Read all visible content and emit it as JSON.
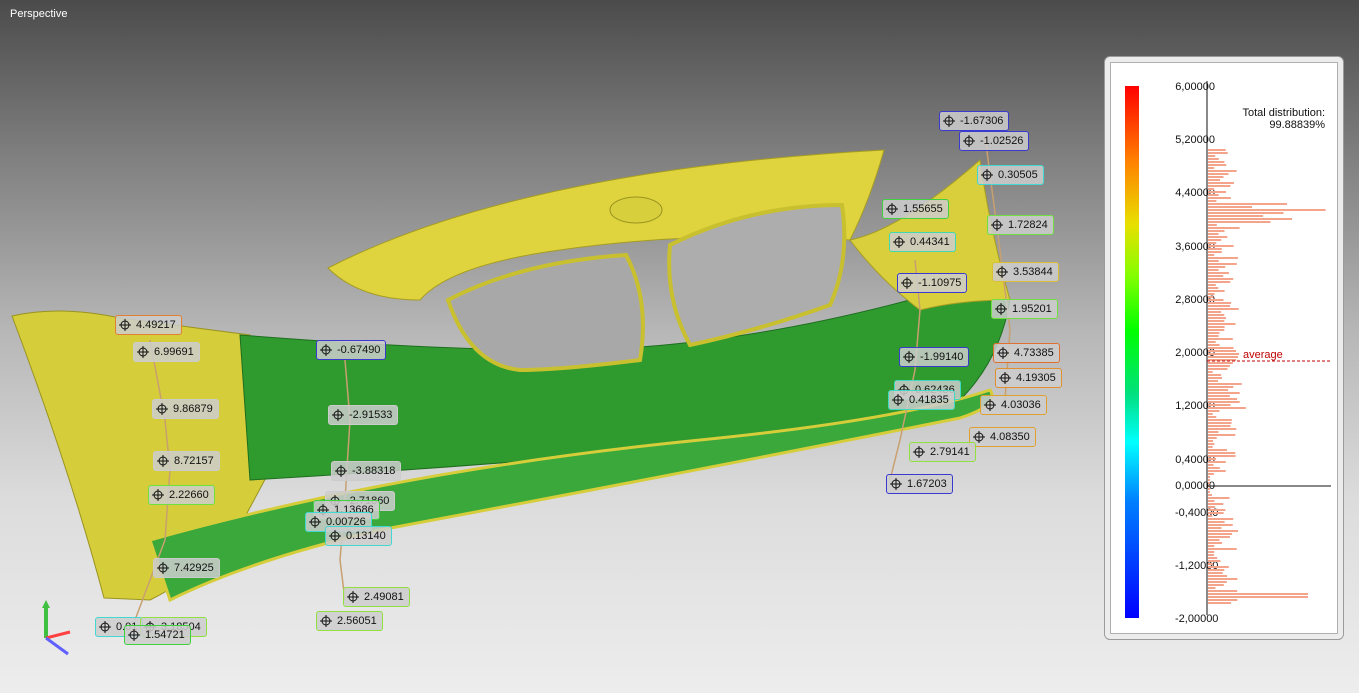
{
  "viewport": {
    "title": "Perspective"
  },
  "colors": {
    "model_yellow": "#d8cf3c",
    "model_green": "#2e9a2e",
    "hist_bar": "#f3a48a",
    "average_line": "#c00000"
  },
  "icons": {
    "callout": "crosshair-icon",
    "axis": "axis-triad-icon"
  },
  "callouts": [
    {
      "value": "-1.67306",
      "border": "#3a3ad0"
    },
    {
      "value": "-1.02526",
      "border": "#3a3ad0"
    },
    {
      "value": "0.30505",
      "border": "#40d8d0"
    },
    {
      "value": "1.55655",
      "border": "#40d040"
    },
    {
      "value": "1.72824",
      "border": "#70e040"
    },
    {
      "value": "0.44341",
      "border": "#40d8b0"
    },
    {
      "value": "3.53844",
      "border": "#d8c030"
    },
    {
      "value": "-1.10975",
      "border": "#3a3ad0"
    },
    {
      "value": "1.95201",
      "border": "#70e040"
    },
    {
      "value": "4.49217",
      "border": "#e08030"
    },
    {
      "value": "6.99691",
      "border": "#cccccc"
    },
    {
      "value": "-0.67490",
      "border": "#3a3ad0"
    },
    {
      "value": "-1.99140",
      "border": "#3a3ad0"
    },
    {
      "value": "4.73385",
      "border": "#e07030"
    },
    {
      "value": "4.19305",
      "border": "#e09030"
    },
    {
      "value": "0.62436",
      "border": "#40d8c0"
    },
    {
      "value": "0.41835",
      "border": "#40d8c0"
    },
    {
      "value": "4.03036",
      "border": "#e0a030"
    },
    {
      "value": "9.86879",
      "border": "#cccccc"
    },
    {
      "value": "-2.91533",
      "border": "#cccccc"
    },
    {
      "value": "4.08350",
      "border": "#e0a030"
    },
    {
      "value": "2.79141",
      "border": "#90e040"
    },
    {
      "value": "8.72157",
      "border": "#cccccc"
    },
    {
      "value": "-3.88318",
      "border": "#cccccc"
    },
    {
      "value": "1.67203",
      "border": "#3a3ad0"
    },
    {
      "value": "2.22660",
      "border": "#70e040"
    },
    {
      "value": "-2.71860",
      "border": "#cccccc"
    },
    {
      "value": "1.13686",
      "border": "#40d040"
    },
    {
      "value": "0.00726",
      "border": "#40d8d0"
    },
    {
      "value": "0.13140",
      "border": "#40d8d0"
    },
    {
      "value": "7.42925",
      "border": "#cccccc"
    },
    {
      "value": "2.49081",
      "border": "#90e040"
    },
    {
      "value": "0.01",
      "border": "#40d8d0"
    },
    {
      "value": "3.18504",
      "border": "#90e040"
    },
    {
      "value": "1.54721",
      "border": "#40d040"
    },
    {
      "value": "2.56051",
      "border": "#90e040"
    }
  ],
  "legend": {
    "title_line1": "Total distribution:",
    "title_line2": "99.88839%",
    "average_label": "average",
    "ticks": [
      "6,00000",
      "5,20000",
      "4,40000",
      "3,60000",
      "2,80000",
      "2,00000",
      "1,20000",
      "0,40000",
      "0,00000",
      "-0,40000",
      "-1,20000",
      "-2,00000"
    ]
  }
}
